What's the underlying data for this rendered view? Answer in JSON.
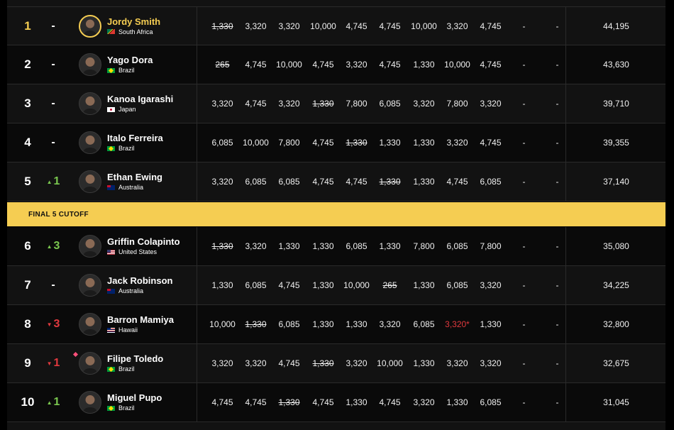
{
  "cutoff_label": "FINAL 5 CUTOFF",
  "rows": [
    {
      "rank": "1",
      "move": "-",
      "move_dir": "none",
      "name": "Jordy Smith",
      "country": "South Africa",
      "flag": "za",
      "highlight": true,
      "scores": [
        {
          "v": "1,330",
          "d": true
        },
        {
          "v": "3,320"
        },
        {
          "v": "3,320"
        },
        {
          "v": "10,000"
        },
        {
          "v": "4,745"
        },
        {
          "v": "4,745"
        },
        {
          "v": "10,000"
        },
        {
          "v": "3,320"
        },
        {
          "v": "4,745"
        },
        {
          "v": "-"
        },
        {
          "v": "-"
        }
      ],
      "total": "44,195"
    },
    {
      "rank": "2",
      "move": "-",
      "move_dir": "none",
      "name": "Yago Dora",
      "country": "Brazil",
      "flag": "br",
      "scores": [
        {
          "v": "265",
          "d": true
        },
        {
          "v": "4,745"
        },
        {
          "v": "10,000"
        },
        {
          "v": "4,745"
        },
        {
          "v": "3,320"
        },
        {
          "v": "4,745"
        },
        {
          "v": "1,330"
        },
        {
          "v": "10,000"
        },
        {
          "v": "4,745"
        },
        {
          "v": "-"
        },
        {
          "v": "-"
        }
      ],
      "total": "43,630"
    },
    {
      "rank": "3",
      "move": "-",
      "move_dir": "none",
      "name": "Kanoa Igarashi",
      "country": "Japan",
      "flag": "jp",
      "scores": [
        {
          "v": "3,320"
        },
        {
          "v": "4,745"
        },
        {
          "v": "3,320"
        },
        {
          "v": "1,330",
          "d": true
        },
        {
          "v": "7,800"
        },
        {
          "v": "6,085"
        },
        {
          "v": "3,320"
        },
        {
          "v": "7,800"
        },
        {
          "v": "3,320"
        },
        {
          "v": "-"
        },
        {
          "v": "-"
        }
      ],
      "total": "39,710"
    },
    {
      "rank": "4",
      "move": "-",
      "move_dir": "none",
      "name": "Italo Ferreira",
      "country": "Brazil",
      "flag": "br",
      "scores": [
        {
          "v": "6,085"
        },
        {
          "v": "10,000"
        },
        {
          "v": "7,800"
        },
        {
          "v": "4,745"
        },
        {
          "v": "1,330",
          "d": true
        },
        {
          "v": "1,330"
        },
        {
          "v": "1,330"
        },
        {
          "v": "3,320"
        },
        {
          "v": "4,745"
        },
        {
          "v": "-"
        },
        {
          "v": "-"
        }
      ],
      "total": "39,355"
    },
    {
      "rank": "5",
      "move": "1",
      "move_dir": "up",
      "name": "Ethan Ewing",
      "country": "Australia",
      "flag": "au",
      "scores": [
        {
          "v": "3,320"
        },
        {
          "v": "6,085"
        },
        {
          "v": "6,085"
        },
        {
          "v": "4,745"
        },
        {
          "v": "4,745"
        },
        {
          "v": "1,330",
          "d": true
        },
        {
          "v": "1,330"
        },
        {
          "v": "4,745"
        },
        {
          "v": "6,085"
        },
        {
          "v": "-"
        },
        {
          "v": "-"
        }
      ],
      "total": "37,140"
    },
    {
      "rank": "6",
      "move": "3",
      "move_dir": "up",
      "name": "Griffin Colapinto",
      "country": "United States",
      "flag": "us",
      "scores": [
        {
          "v": "1,330",
          "d": true
        },
        {
          "v": "3,320"
        },
        {
          "v": "1,330"
        },
        {
          "v": "1,330"
        },
        {
          "v": "6,085"
        },
        {
          "v": "1,330"
        },
        {
          "v": "7,800"
        },
        {
          "v": "6,085"
        },
        {
          "v": "7,800"
        },
        {
          "v": "-"
        },
        {
          "v": "-"
        }
      ],
      "total": "35,080"
    },
    {
      "rank": "7",
      "move": "-",
      "move_dir": "none",
      "name": "Jack Robinson",
      "country": "Australia",
      "flag": "au",
      "scores": [
        {
          "v": "1,330"
        },
        {
          "v": "6,085"
        },
        {
          "v": "4,745"
        },
        {
          "v": "1,330"
        },
        {
          "v": "10,000"
        },
        {
          "v": "265",
          "d": true
        },
        {
          "v": "1,330"
        },
        {
          "v": "6,085"
        },
        {
          "v": "3,320"
        },
        {
          "v": "-"
        },
        {
          "v": "-"
        }
      ],
      "total": "34,225"
    },
    {
      "rank": "8",
      "move": "3",
      "move_dir": "down",
      "name": "Barron Mamiya",
      "country": "Hawaii",
      "flag": "hi",
      "scores": [
        {
          "v": "10,000"
        },
        {
          "v": "1,330",
          "d": true
        },
        {
          "v": "6,085"
        },
        {
          "v": "1,330"
        },
        {
          "v": "1,330"
        },
        {
          "v": "3,320"
        },
        {
          "v": "6,085"
        },
        {
          "v": "3,320*",
          "red": true
        },
        {
          "v": "1,330"
        },
        {
          "v": "-"
        },
        {
          "v": "-"
        }
      ],
      "total": "32,800"
    },
    {
      "rank": "9",
      "move": "1",
      "move_dir": "down",
      "name": "Filipe Toledo",
      "country": "Brazil",
      "flag": "br",
      "marker": true,
      "scores": [
        {
          "v": "3,320"
        },
        {
          "v": "3,320"
        },
        {
          "v": "4,745"
        },
        {
          "v": "1,330",
          "d": true
        },
        {
          "v": "3,320"
        },
        {
          "v": "10,000"
        },
        {
          "v": "1,330"
        },
        {
          "v": "3,320"
        },
        {
          "v": "3,320"
        },
        {
          "v": "-"
        },
        {
          "v": "-"
        }
      ],
      "total": "32,675"
    },
    {
      "rank": "10",
      "move": "1",
      "move_dir": "up",
      "name": "Miguel Pupo",
      "country": "Brazil",
      "flag": "br",
      "scores": [
        {
          "v": "4,745"
        },
        {
          "v": "4,745"
        },
        {
          "v": "1,330",
          "d": true
        },
        {
          "v": "4,745"
        },
        {
          "v": "1,330"
        },
        {
          "v": "4,745"
        },
        {
          "v": "3,320"
        },
        {
          "v": "1,330"
        },
        {
          "v": "6,085"
        },
        {
          "v": "-"
        },
        {
          "v": "-"
        }
      ],
      "total": "31,045"
    }
  ]
}
